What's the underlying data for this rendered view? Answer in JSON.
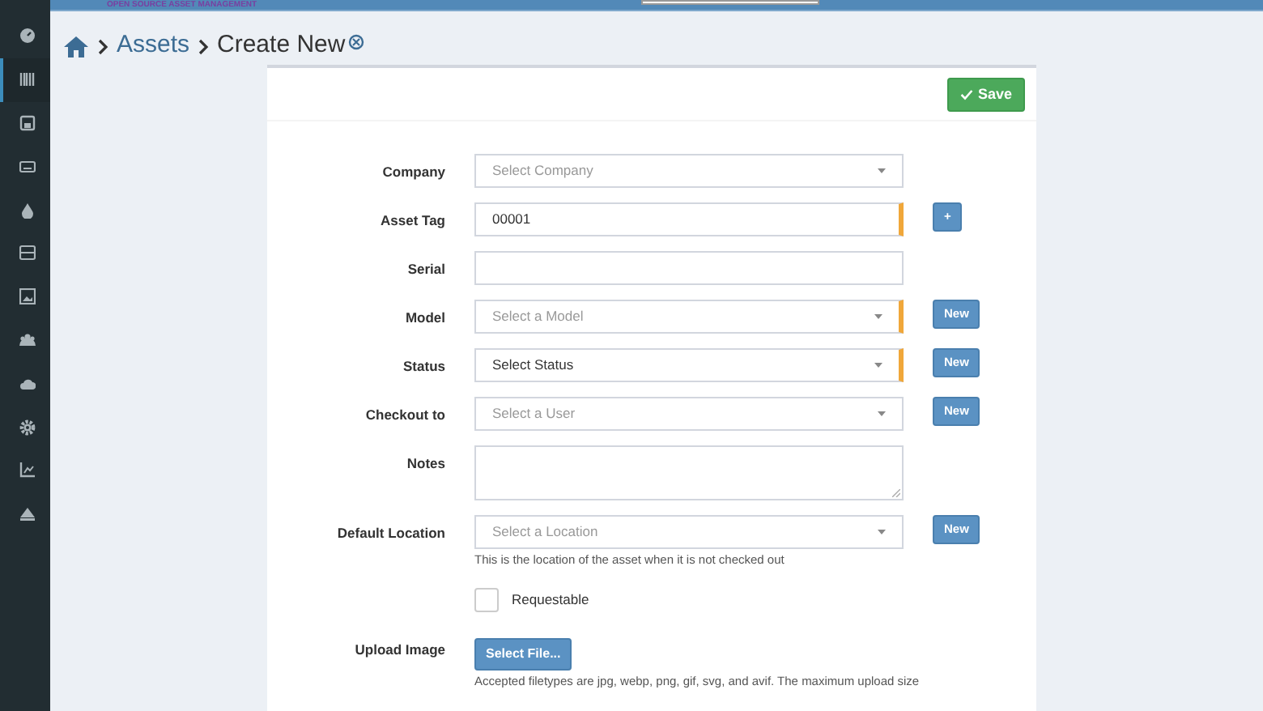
{
  "header": {
    "tagline": "OPEN SOURCE ASSET MANAGEMENT"
  },
  "sidebar": {
    "items": [
      {
        "selected": false
      },
      {
        "selected": true
      },
      {
        "selected": false
      },
      {
        "selected": false
      },
      {
        "selected": false
      },
      {
        "selected": false
      },
      {
        "selected": false
      },
      {
        "selected": false
      },
      {
        "selected": false
      },
      {
        "selected": false
      },
      {
        "selected": false
      },
      {
        "selected": false
      }
    ]
  },
  "breadcrumb": {
    "link": "Assets",
    "current": "Create New"
  },
  "save_button": "Save",
  "fields": [
    {
      "kind": "select",
      "label": "Company",
      "placeholder": "Select Company",
      "required": false
    },
    {
      "kind": "text",
      "label": "Asset Tag",
      "value": "00001",
      "required": true,
      "button": "+"
    },
    {
      "kind": "text",
      "label": "Serial",
      "required": false
    },
    {
      "kind": "select",
      "label": "Model",
      "placeholder": "Select a Model",
      "required": true,
      "button": "New"
    },
    {
      "kind": "select",
      "label": "Status",
      "value": "Select Status",
      "required": true,
      "button": "New"
    },
    {
      "kind": "select",
      "label": "Checkout to",
      "placeholder": "Select a User",
      "required": false,
      "button": "New"
    },
    {
      "kind": "textarea",
      "label": "Notes",
      "required": false
    },
    {
      "kind": "select",
      "label": "Default Location",
      "placeholder": "Select a Location",
      "required": false,
      "button": "New",
      "help": "This is the location of the asset when it is not checked out"
    },
    {
      "kind": "checkbox",
      "label": "Requestable",
      "checked": false
    },
    {
      "kind": "file",
      "label": "Upload Image",
      "button": "Select File...",
      "help": "Accepted filetypes are jpg, webp, png, gif, svg, and avif. The maximum upload size"
    }
  ]
}
